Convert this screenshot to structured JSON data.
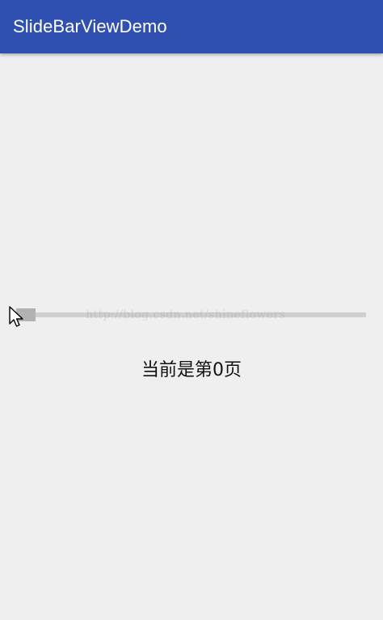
{
  "app": {
    "title": "SlideBarViewDemo"
  },
  "slide_bar": {
    "current_page": 0,
    "position_fraction": 0
  },
  "status": {
    "page_text": "当前是第0页"
  },
  "watermark": {
    "text": "http://blog.csdn.net/shineflowers"
  },
  "colors": {
    "app_bar": "#2f50b1",
    "background": "#efefef",
    "track": "#cfcfcf",
    "thumb": "#b2b2b2",
    "text": "#111111"
  },
  "icons": {
    "mouse_pointer": "mouse-pointer-icon"
  }
}
